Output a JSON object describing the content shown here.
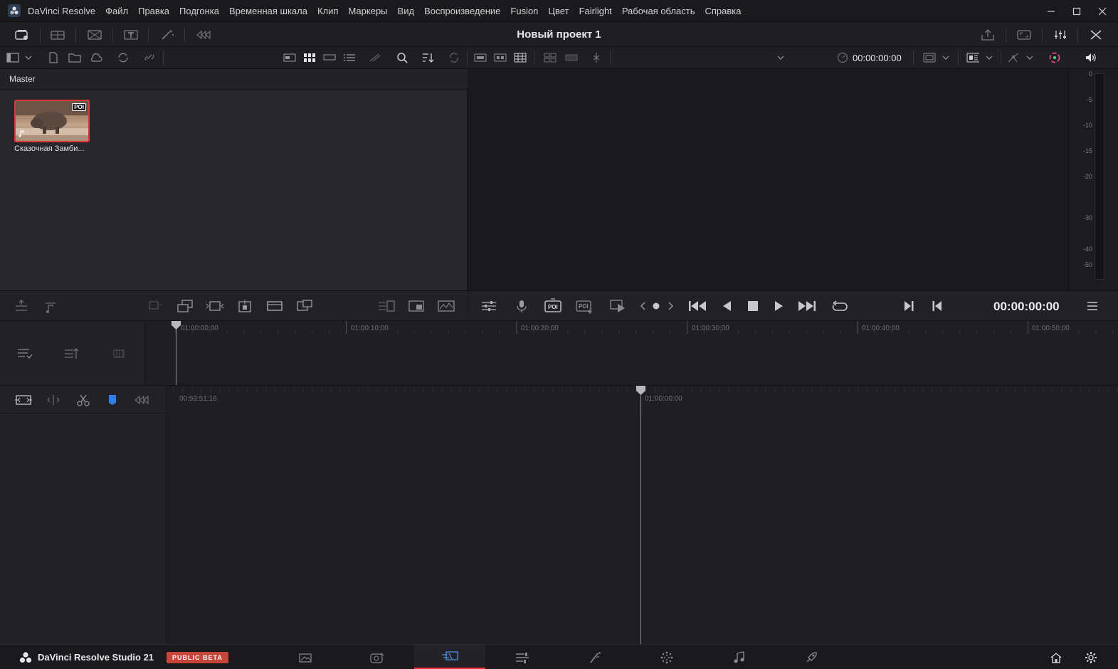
{
  "menubar": {
    "app_name": "DaVinci Resolve",
    "items": [
      "Файл",
      "Правка",
      "Подгонка",
      "Временная шкала",
      "Клип",
      "Маркеры",
      "Вид",
      "Воспроизведение",
      "Fusion",
      "Цвет",
      "Fairlight",
      "Рабочая область",
      "Справка"
    ]
  },
  "toolbar": {
    "project_title": "Новый проект 1"
  },
  "toolbar2": {
    "viewer_timecode": "00:00:00:00"
  },
  "media_pool": {
    "bin_name": "Master",
    "clip": {
      "name": "Сказочная Замби...",
      "badge": "POI"
    }
  },
  "audio_meter": {
    "scale": [
      "0",
      "-5",
      "-10",
      "-15",
      "-20",
      "-30",
      "-40",
      "-50"
    ]
  },
  "transport": {
    "timecode": "00:00:00:00"
  },
  "upper_timeline": {
    "ruler": [
      "01:00:00:00",
      "01:00:10:00",
      "01:00:20:00",
      "01:00:30:00",
      "01:00:40:00",
      "01:00:50:00"
    ]
  },
  "lower_timeline": {
    "ruler": [
      "00:59:51:16",
      "01:00:00:00"
    ]
  },
  "pagebar": {
    "brand": "DaVinci Resolve Studio 21",
    "badge": "PUBLIC BETA",
    "pages": [
      "media-page-icon",
      "cut-page-icon",
      "edit-page-icon",
      "fusion-page-icon",
      "color-page-icon",
      "fairlight-page-icon",
      "deliver-page-icon"
    ],
    "active_page": "edit-page-icon"
  },
  "colors": {
    "accent_red": "#e0313b",
    "selection_red": "#d8393a",
    "marker_blue": "#2f7fe8",
    "beta_badge": "#c8453a"
  }
}
